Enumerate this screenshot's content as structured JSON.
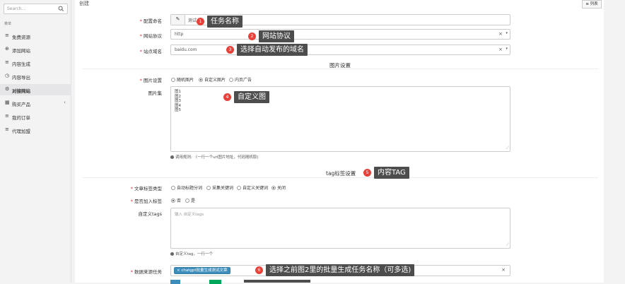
{
  "sidebar": {
    "search_placeholder": "Search...",
    "section_header": "菜单",
    "items": [
      {
        "label": "免费资源",
        "icon": "≡"
      },
      {
        "label": "添加网站",
        "icon": "⊕"
      },
      {
        "label": "内容生成",
        "icon": "≡"
      },
      {
        "label": "内容导出",
        "icon": "◷"
      },
      {
        "label": "对接网站",
        "icon": "⚙"
      },
      {
        "label": "购买产品",
        "icon": "▦",
        "chevron": "‹"
      },
      {
        "label": "我的订单",
        "icon": "≡"
      },
      {
        "label": "代理加盟",
        "icon": "≡"
      }
    ]
  },
  "header": {
    "title": "创建",
    "list_button": "≡ 列表"
  },
  "form": {
    "task_name": {
      "label": "配置命名",
      "value": "测试"
    },
    "protocol": {
      "label": "网站协议",
      "value": "http"
    },
    "domain": {
      "label": "站点域名",
      "value": "baidu.com"
    },
    "image_section": "图片设置",
    "image_type": {
      "label": "图片设置",
      "options": [
        "随机图片",
        "自定义图片",
        "内页广告"
      ],
      "selected_index": 1
    },
    "image_set": {
      "label": "图片集",
      "lines": "图1\n图2\n图3\n图4\n图5"
    },
    "image_hint": "调用规则: （一行一个url图片地址，代码随机取)",
    "tag_section": "tag标签设置",
    "tag_type": {
      "label": "文章标签类型",
      "options": [
        "自动标题分词",
        "采集关键词",
        "自定义关键词",
        "关闭"
      ],
      "selected_index": 3
    },
    "add_tag": {
      "label": "是否加入标签",
      "options": [
        "否",
        "是"
      ],
      "selected_index": 0
    },
    "custom_tags": {
      "label": "自定义tags",
      "placeholder": "输入 自定义tags"
    },
    "tags_hint": "自定义tag，一行一个",
    "source_task": {
      "label": "数据来源任务",
      "chip": "× chatgpt批量生成测试文章"
    }
  },
  "callouts": [
    {
      "num": "1",
      "text": "任务名称"
    },
    {
      "num": "2",
      "text": "网站协议"
    },
    {
      "num": "3",
      "text": "选择自动发布的域名"
    },
    {
      "num": "4",
      "text": "自定义图"
    },
    {
      "num": "5",
      "text": "内容TAG"
    },
    {
      "num": "6",
      "text": "选择之前图2里的批量生成任务名称（可多选)"
    }
  ],
  "colors": {
    "callout_bg": "#4d4d4d",
    "callout_num": "#e8413a",
    "chip": "#3c8dbc",
    "required": "#e22233"
  }
}
